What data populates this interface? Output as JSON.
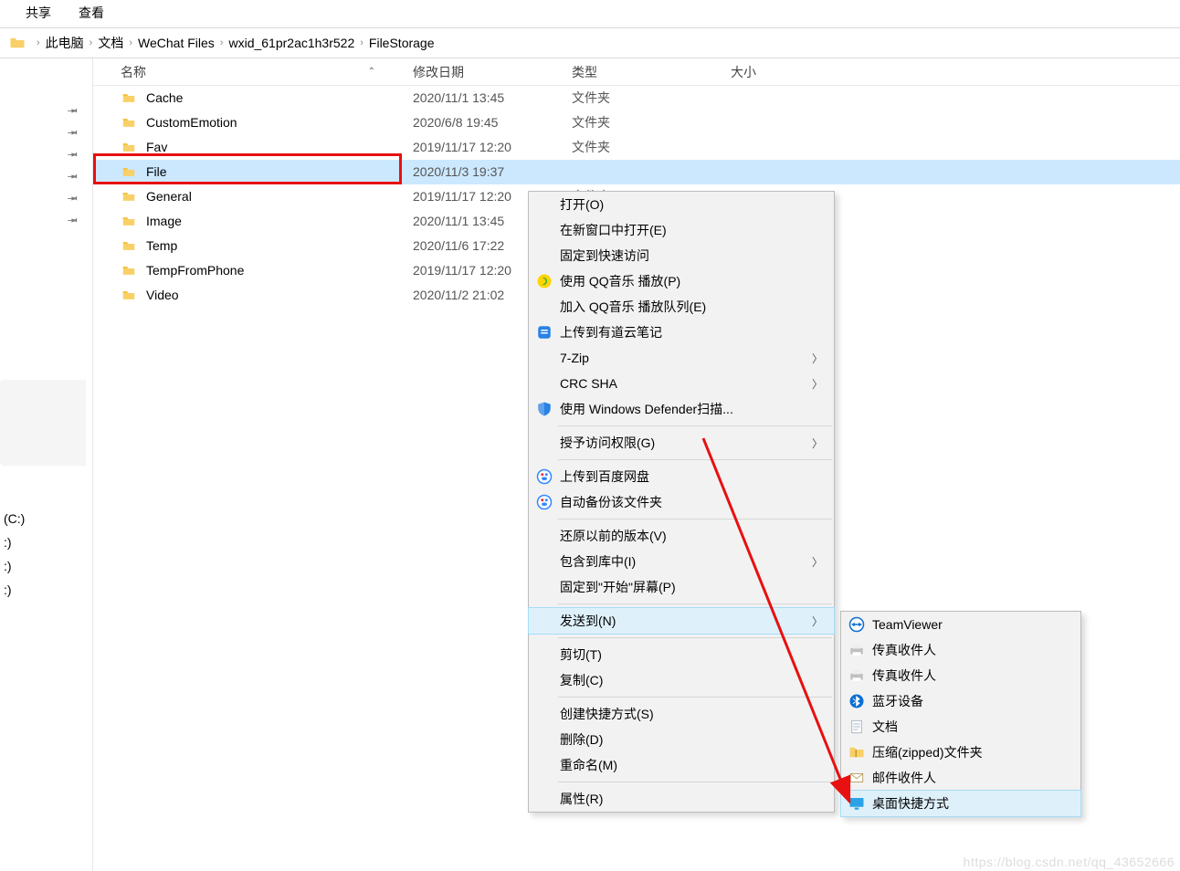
{
  "ribbon": {
    "share": "共享",
    "view": "查看"
  },
  "crumbs": [
    "此电脑",
    "文档",
    "WeChat Files",
    "wxid_61pr2ac1h3r522",
    "FileStorage"
  ],
  "drives": [
    "(C:)",
    ":)",
    ":)",
    ":)"
  ],
  "columns": {
    "name": "名称",
    "date": "修改日期",
    "type": "类型",
    "size": "大小"
  },
  "type_label": "文件夹",
  "rows": [
    {
      "name": "Cache",
      "date": "2020/11/1 13:45",
      "sel": false
    },
    {
      "name": "CustomEmotion",
      "date": "2020/6/8 19:45",
      "sel": false
    },
    {
      "name": "Fav",
      "date": "2019/11/17 12:20",
      "sel": false
    },
    {
      "name": "File",
      "date": "2020/11/3 19:37",
      "sel": true
    },
    {
      "name": "General",
      "date": "2019/11/17 12:20",
      "sel": false
    },
    {
      "name": "Image",
      "date": "2020/11/1 13:45",
      "sel": false
    },
    {
      "name": "Temp",
      "date": "2020/11/6 17:22",
      "sel": false
    },
    {
      "name": "TempFromPhone",
      "date": "2019/11/17 12:20",
      "sel": false
    },
    {
      "name": "Video",
      "date": "2020/11/2 21:02",
      "sel": false
    }
  ],
  "menu": [
    {
      "t": "item",
      "label": "打开(O)"
    },
    {
      "t": "item",
      "label": "在新窗口中打开(E)"
    },
    {
      "t": "item",
      "label": "固定到快速访问"
    },
    {
      "t": "item",
      "label": "使用 QQ音乐 播放(P)",
      "icon": "qqmusic"
    },
    {
      "t": "item",
      "label": "加入 QQ音乐 播放队列(E)"
    },
    {
      "t": "item",
      "label": "上传到有道云笔记",
      "icon": "youdao"
    },
    {
      "t": "item",
      "label": "7-Zip",
      "arrow": true
    },
    {
      "t": "item",
      "label": "CRC SHA",
      "arrow": true
    },
    {
      "t": "item",
      "label": "使用 Windows Defender扫描...",
      "icon": "defender"
    },
    {
      "t": "sep"
    },
    {
      "t": "item",
      "label": "授予访问权限(G)",
      "arrow": true
    },
    {
      "t": "sep"
    },
    {
      "t": "item",
      "label": "上传到百度网盘",
      "icon": "baidu"
    },
    {
      "t": "item",
      "label": "自动备份该文件夹",
      "icon": "baidu"
    },
    {
      "t": "sep"
    },
    {
      "t": "item",
      "label": "还原以前的版本(V)"
    },
    {
      "t": "item",
      "label": "包含到库中(I)",
      "arrow": true
    },
    {
      "t": "item",
      "label": "固定到\"开始\"屏幕(P)"
    },
    {
      "t": "sep"
    },
    {
      "t": "item",
      "label": "发送到(N)",
      "arrow": true,
      "hi": true
    },
    {
      "t": "sep"
    },
    {
      "t": "item",
      "label": "剪切(T)"
    },
    {
      "t": "item",
      "label": "复制(C)"
    },
    {
      "t": "sep"
    },
    {
      "t": "item",
      "label": "创建快捷方式(S)"
    },
    {
      "t": "item",
      "label": "删除(D)"
    },
    {
      "t": "item",
      "label": "重命名(M)"
    },
    {
      "t": "sep"
    },
    {
      "t": "item",
      "label": "属性(R)"
    }
  ],
  "submenu": [
    {
      "label": "TeamViewer",
      "icon": "teamviewer"
    },
    {
      "label": "传真收件人",
      "icon": "fax"
    },
    {
      "label": "传真收件人",
      "icon": "fax"
    },
    {
      "label": "蓝牙设备",
      "icon": "bluetooth"
    },
    {
      "label": "文档",
      "icon": "doc"
    },
    {
      "label": "压缩(zipped)文件夹",
      "icon": "zip"
    },
    {
      "label": "邮件收件人",
      "icon": "mail"
    },
    {
      "label": "桌面快捷方式",
      "icon": "desktop",
      "hi": true
    }
  ],
  "watermark": "https://blog.csdn.net/qq_43652666"
}
